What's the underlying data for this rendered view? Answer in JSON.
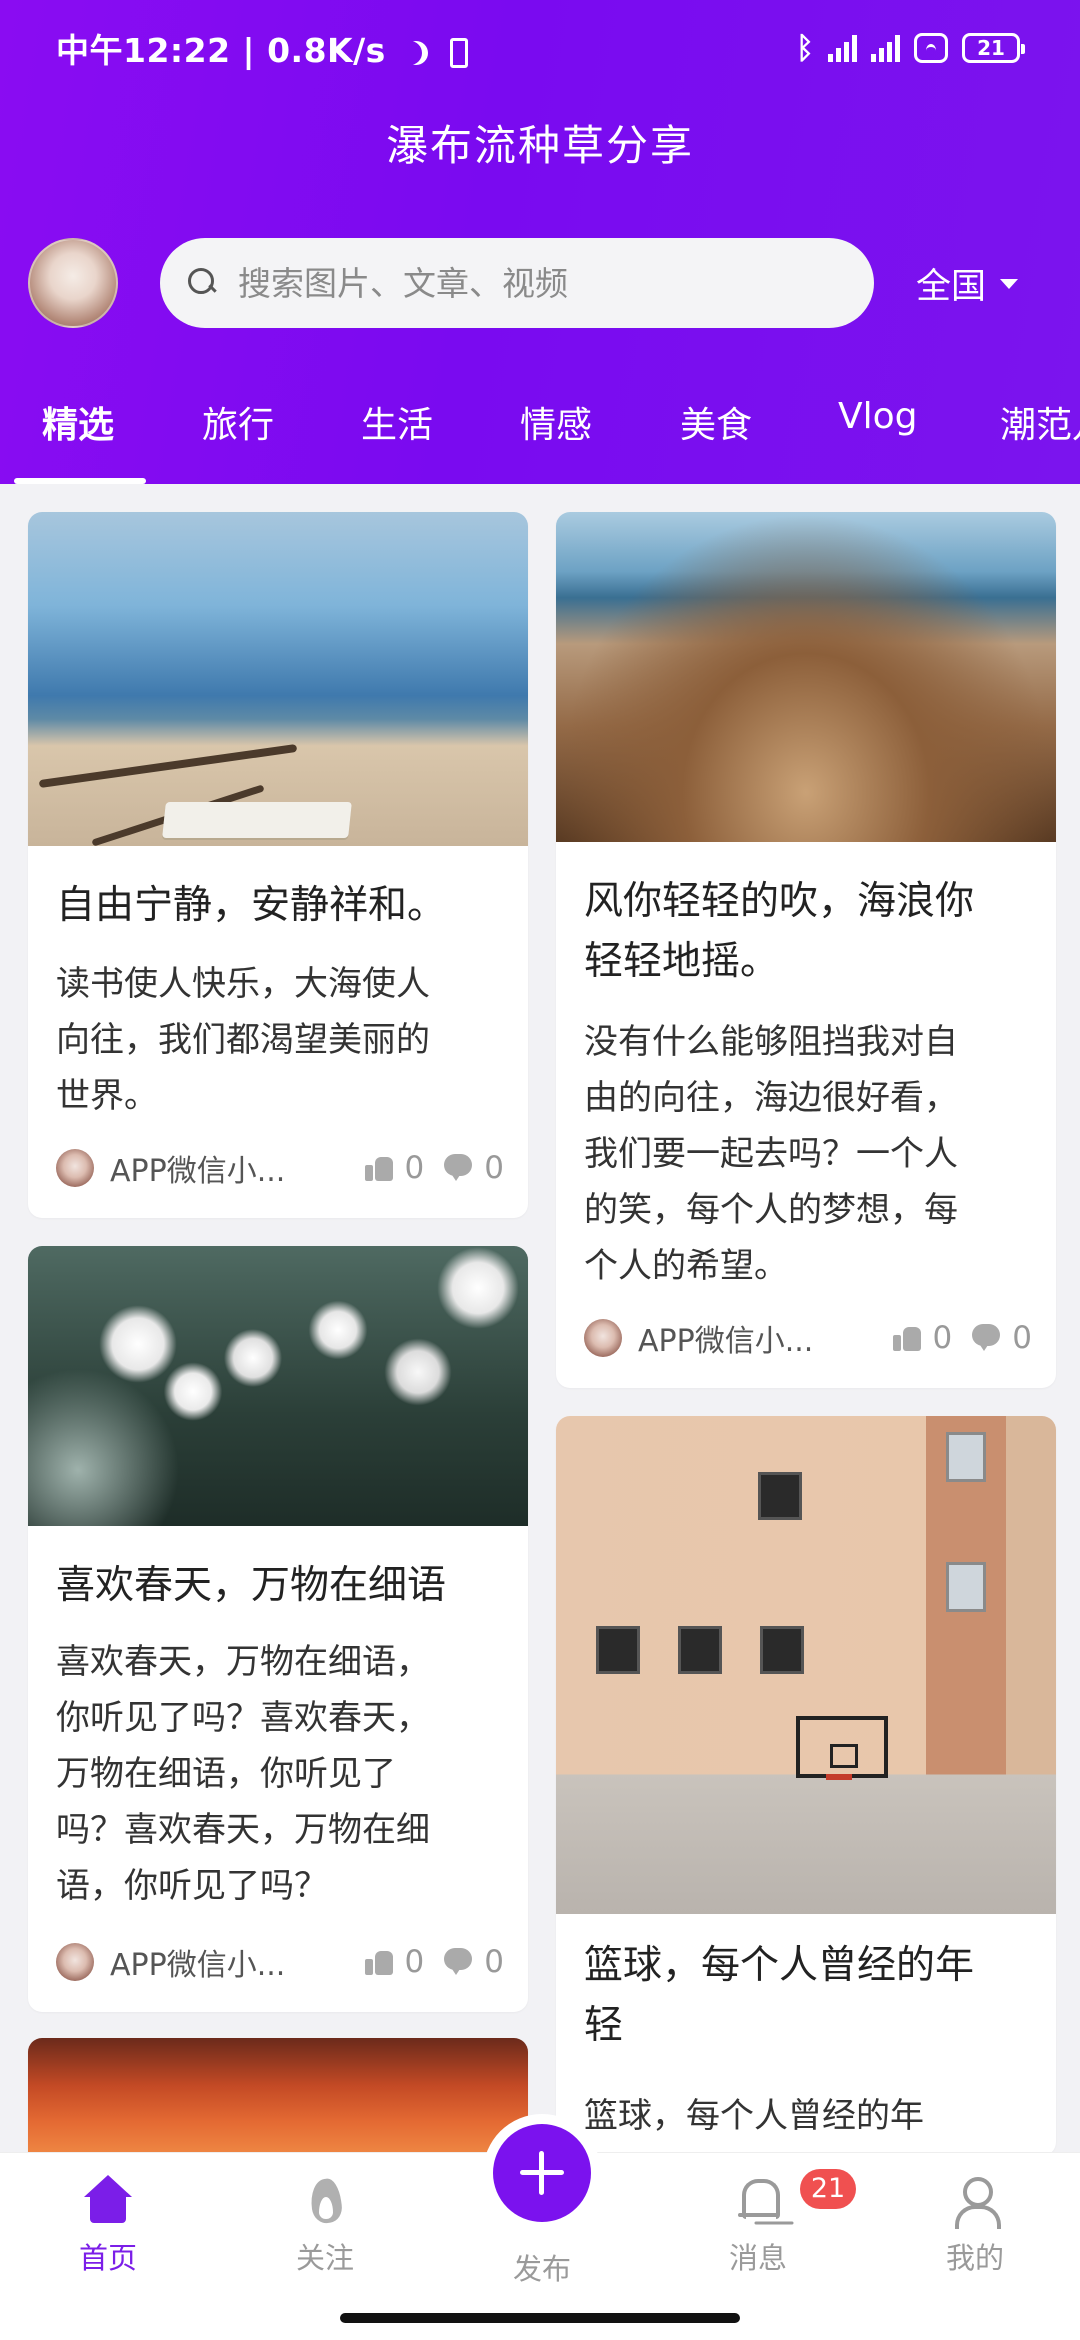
{
  "status_bar": {
    "time_speed": "中午12:22 | 0.8K/s",
    "bluetooth": "ʙ",
    "battery": "21"
  },
  "header": {
    "title": "瀑布流种草分享",
    "search_placeholder": "搜索图片、文章、视频",
    "region": "全国"
  },
  "tabs": [
    "精选",
    "旅行",
    "生活",
    "情感",
    "美食",
    "Vlog",
    "潮范儿"
  ],
  "active_tab_index": 0,
  "feed": {
    "left": [
      {
        "title": "自由宁静，安静祥和。",
        "desc": [
          "读书使人快乐，大海使人",
          "向往，我们都渴望美丽的",
          "世界。"
        ],
        "author": "APP微信小...",
        "likes": "0",
        "comments": "0"
      },
      {
        "title": "喜欢春天，万物在细语",
        "desc": [
          "喜欢春天，万物在细语，",
          "你听见了吗？喜欢春天，",
          "万物在细语，你听见了",
          "吗？喜欢春天，万物在细",
          "语，你听见了吗？"
        ],
        "author": "APP微信小...",
        "likes": "0",
        "comments": "0"
      }
    ],
    "right": [
      {
        "title": [
          "风你轻轻的吹，海浪你",
          "轻轻地摇。"
        ],
        "desc": [
          "没有什么能够阻挡我对自",
          "由的向往，海边很好看，",
          "我们要一起去吗？一个人",
          "的笑，每个人的梦想，每",
          "个人的希望。"
        ],
        "author": "APP微信小...",
        "likes": "0",
        "comments": "0"
      },
      {
        "title": [
          "篮球，每个人曾经的年",
          "轻"
        ],
        "desc": [
          "篮球，每个人曾经的年"
        ]
      }
    ]
  },
  "bottom_nav": {
    "home": "首页",
    "follow": "关注",
    "publish": "发布",
    "messages": "消息",
    "messages_badge": "21",
    "mine": "我的"
  },
  "colors": {
    "accent": "#7b12ee",
    "header_gradient_start": "#8a0cf2",
    "badge": "#f05050"
  }
}
